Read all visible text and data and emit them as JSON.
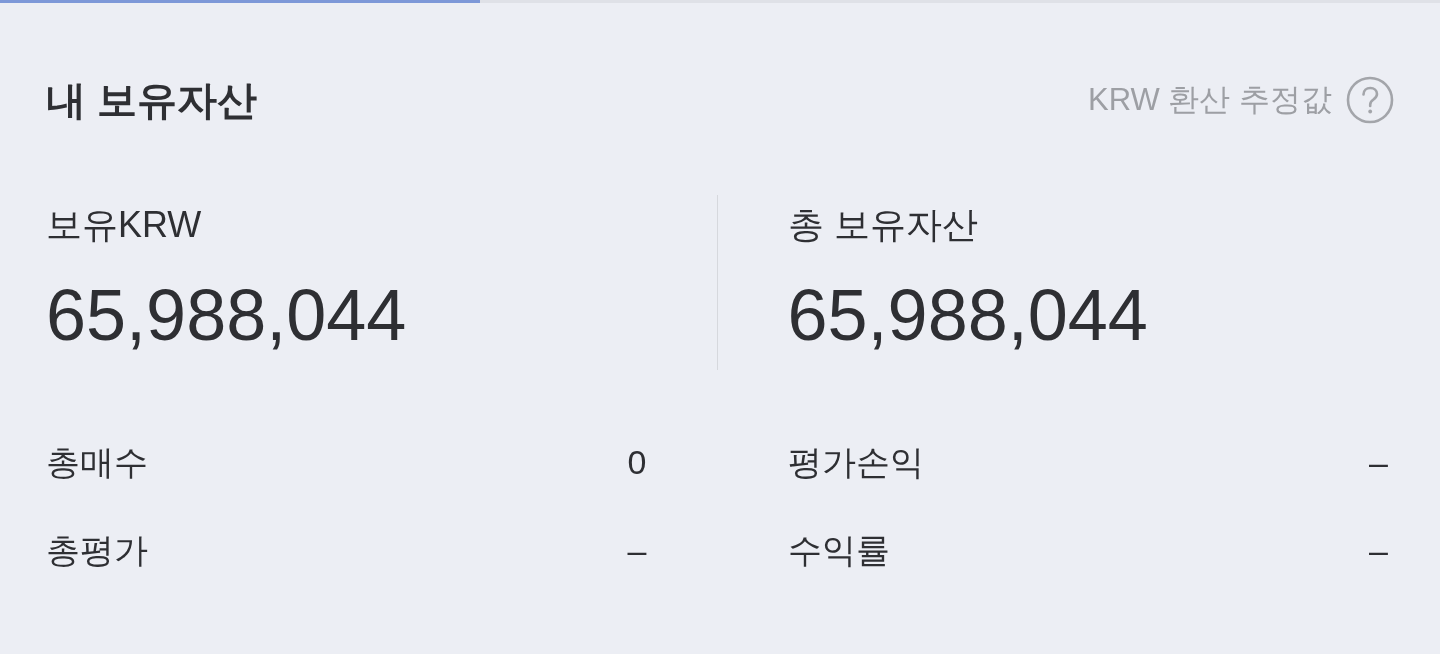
{
  "tabs": [
    {
      "selected": true
    },
    {
      "selected": false
    },
    {
      "selected": false
    }
  ],
  "header": {
    "title": "내 보유자산",
    "note": "KRW 환산 추정값"
  },
  "columns": [
    {
      "label": "보유KRW",
      "amount": "65,988,044",
      "stats": [
        {
          "label": "총매수",
          "value": "0"
        },
        {
          "label": "총평가",
          "value": "–"
        }
      ]
    },
    {
      "label": "총 보유자산",
      "amount": "65,988,044",
      "stats": [
        {
          "label": "평가손익",
          "value": "–"
        },
        {
          "label": "수익률",
          "value": "–"
        }
      ]
    }
  ]
}
